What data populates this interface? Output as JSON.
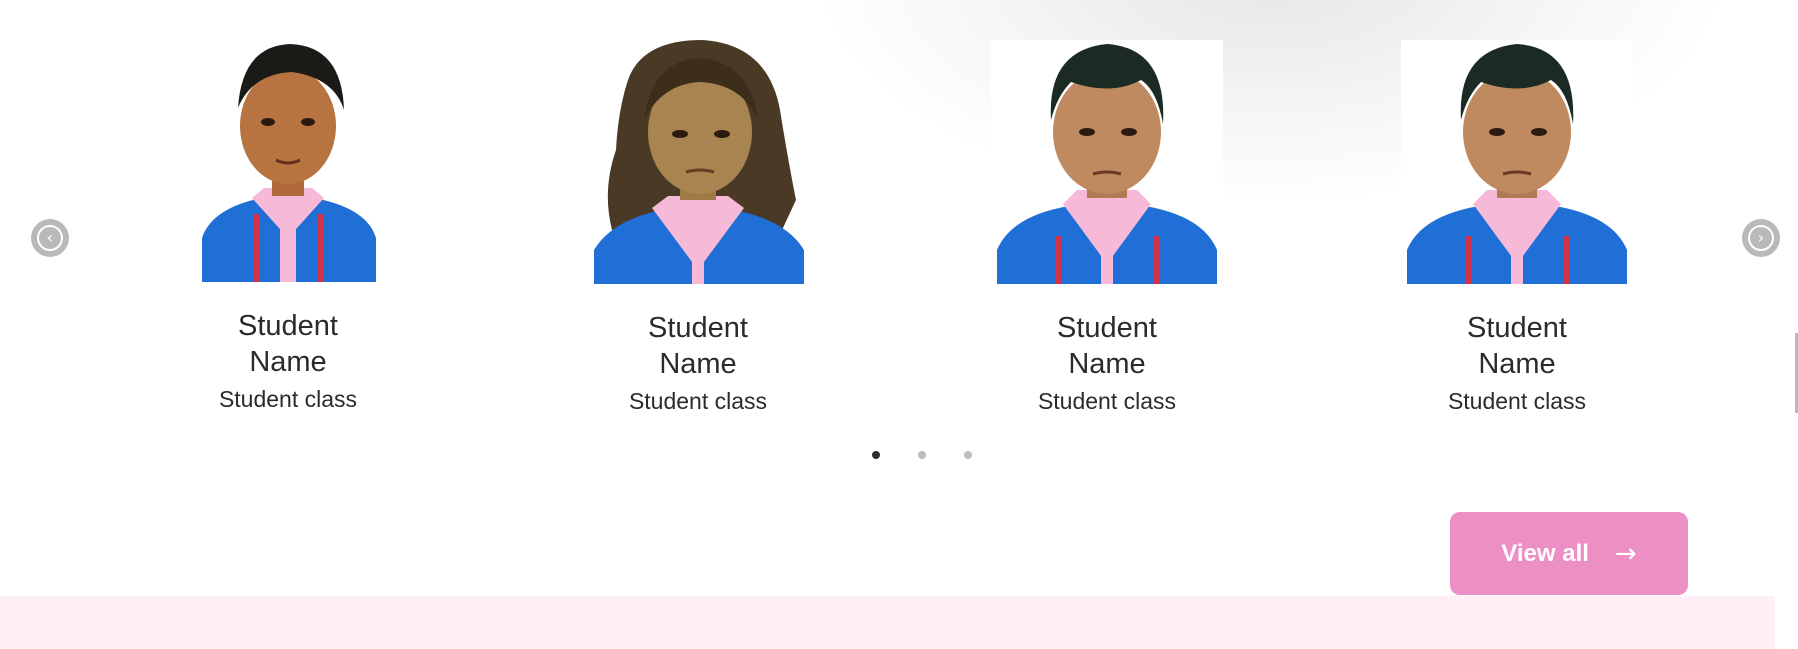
{
  "carousel": {
    "prev_icon": "chevron-left-icon",
    "next_icon": "chevron-right-icon",
    "prev_glyph": "‹",
    "next_glyph": "›",
    "students": [
      {
        "name": "Student Name",
        "class": "Student class",
        "photo": "student-photo-girl-1"
      },
      {
        "name": "Student Name",
        "class": "Student class",
        "photo": "student-photo-girl-2"
      },
      {
        "name": "Student Name",
        "class": "Student class",
        "photo": "student-photo-boy-1"
      },
      {
        "name": "Student Name",
        "class": "Student class",
        "photo": "student-photo-boy-2"
      }
    ],
    "pagination": {
      "count": 3,
      "active_index": 0
    }
  },
  "view_all": {
    "label": "View all",
    "arrow": "→",
    "icon": "arrow-right-icon"
  },
  "colors": {
    "button": "#ec8fc5",
    "footer_band": "#fff0f7",
    "uniform": "#1f6fd6",
    "collar": "#f6b9d8",
    "nav": "#b9b9b9"
  }
}
